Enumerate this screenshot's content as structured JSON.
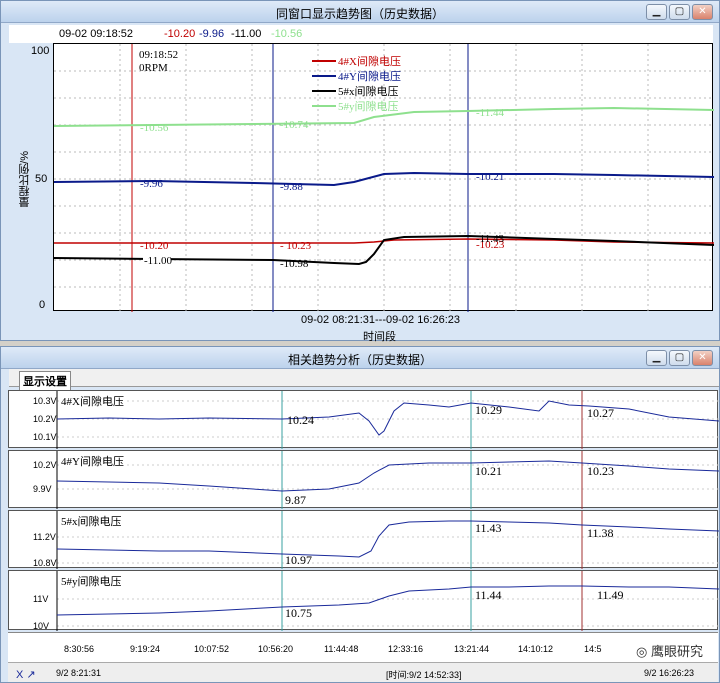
{
  "window1": {
    "title": "同窗口显示趋势图（历史数据）",
    "cursor": {
      "time": "09-02 09:18:52",
      "v1": "-10.20",
      "v2": "-9.96",
      "v3": "-11.00",
      "v4": "-10.56"
    },
    "y_axis": {
      "label": "量程比例/%",
      "ticks": [
        "100",
        "50",
        "0"
      ]
    },
    "x_axis": {
      "range": "09-02 08:21:31---09-02 16:26:23",
      "label": "时间段"
    },
    "cursor_box": {
      "time": "09:18:52",
      "rpm": "0RPM"
    },
    "legend": [
      "4#X间隙电压",
      "4#Y间隙电压",
      "5#x间隙电压",
      "5#y间隙电压"
    ],
    "labels": {
      "red": [
        "-10.20",
        "- 10.23",
        "-10.23"
      ],
      "blue": [
        "-9.96",
        "-9.88",
        "-10.21"
      ],
      "black": [
        "-11.00",
        "-10.98",
        "-11.43"
      ],
      "green": [
        "-10.56",
        "-10.74",
        "-11.44"
      ]
    },
    "colors": {
      "red": "#c00000",
      "blue": "#0a1a8a",
      "black": "#000000",
      "green": "#8ee08e"
    }
  },
  "window2": {
    "title": "相关趋势分析（历史数据）",
    "tab": "显示设置",
    "panels": [
      {
        "name": "4#X间隙电压",
        "yticks": [
          "10.3V",
          "10.2V",
          "10.1V"
        ],
        "vals": [
          "10.24",
          "10.29",
          "10.27"
        ]
      },
      {
        "name": "4#Y间隙电压",
        "yticks": [
          "10.2V",
          "9.9V"
        ],
        "vals": [
          "9.87",
          "10.21",
          "10.23"
        ]
      },
      {
        "name": "5#x间隙电压",
        "yticks": [
          "11.2V",
          "10.8V"
        ],
        "vals": [
          "10.97",
          "11.43",
          "11.38"
        ]
      },
      {
        "name": "5#y间隙电压",
        "yticks": [
          "11V",
          "10V"
        ],
        "vals": [
          "10.75",
          "11.44",
          "11.49"
        ]
      }
    ],
    "time_ticks": [
      "8:30:56",
      "9:19:24",
      "10:07:52",
      "10:56:20",
      "11:44:48",
      "12:33:16",
      "13:21:44",
      "14:10:12",
      "14:5"
    ],
    "status": {
      "icons": "X ↗",
      "start": "9/2  8:21:31",
      "mid": "[时间:9/2 14:52:33]",
      "end": "9/2  16:26:23"
    },
    "watermark": "鹰眼研究"
  }
}
